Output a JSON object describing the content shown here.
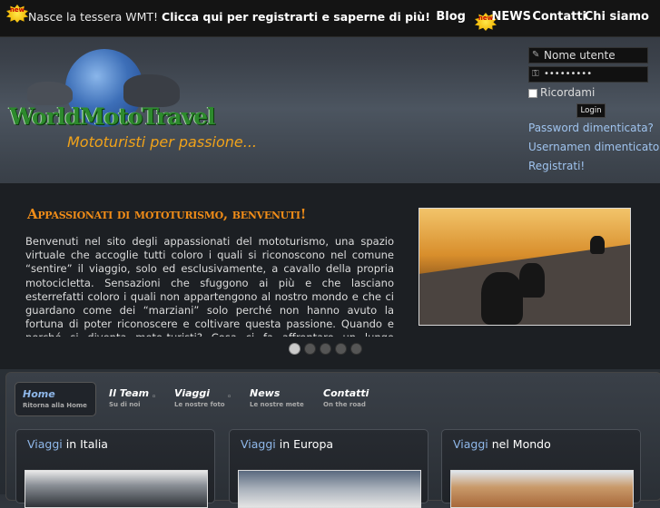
{
  "topbar": {
    "badge_text": "new",
    "message_prefix": "Nasce la tessera WMT!",
    "message_link": "Clicca qui per registrarti e saperne di più!",
    "nav": [
      {
        "label": "Blog"
      },
      {
        "label": "NEWS",
        "badge": "new"
      },
      {
        "label": "Contatti"
      },
      {
        "label": "Chi siamo"
      }
    ]
  },
  "logo": {
    "name": "WorldMotoTravel",
    "tagline": "Mototuristi per passione..."
  },
  "login": {
    "username_placeholder": "Nome utente",
    "password_value": "•••••••••",
    "remember_label": "Ricordami",
    "button_label": "Login",
    "links": [
      "Password dimenticata?",
      "Usernamen dimenticato?",
      "Registrati!"
    ]
  },
  "slide": {
    "title": "Appassionati di mototurismo, benvenuti!",
    "text": "Benvenuti nel sito degli appassionati del mototurismo, una spazio virtuale che accoglie tutti coloro i quali si riconoscono nel comune “sentire” il viaggio, solo ed esclusivamente, a cavallo della propria motocicletta. Sensazioni che sfuggono ai più e che lasciano esterrefatti coloro i quali non appartengono al nostro mondo e che ci guardano come dei “marziani” solo perché non hanno avuto la fortuna di poter riconoscere e coltivare questa passione. Quando e perché si diventa moto-turisti? Cosa ci fa affrontare un lungo itinerario, incuranti delle avversità",
    "dots": 5,
    "active_dot": 1
  },
  "mainnav": [
    {
      "label": "Home",
      "sub": "Ritorna alla Home"
    },
    {
      "label": "Il Team",
      "sub": "Su di noi"
    },
    {
      "label": "Viaggi",
      "sub": "Le nostre foto"
    },
    {
      "label": "News",
      "sub": "Le nostre mete"
    },
    {
      "label": "Contatti",
      "sub": "On the road"
    }
  ],
  "cards": [
    {
      "highlight": "Viaggi",
      "rest": " in Italia"
    },
    {
      "highlight": "Viaggi",
      "rest": " in Europa"
    },
    {
      "highlight": "Viaggi",
      "rest": " nel Mondo"
    }
  ],
  "colors": {
    "accent_orange": "#f08c18",
    "link_blue": "#9fc3ee",
    "logo_green": "#2d8a2d"
  }
}
